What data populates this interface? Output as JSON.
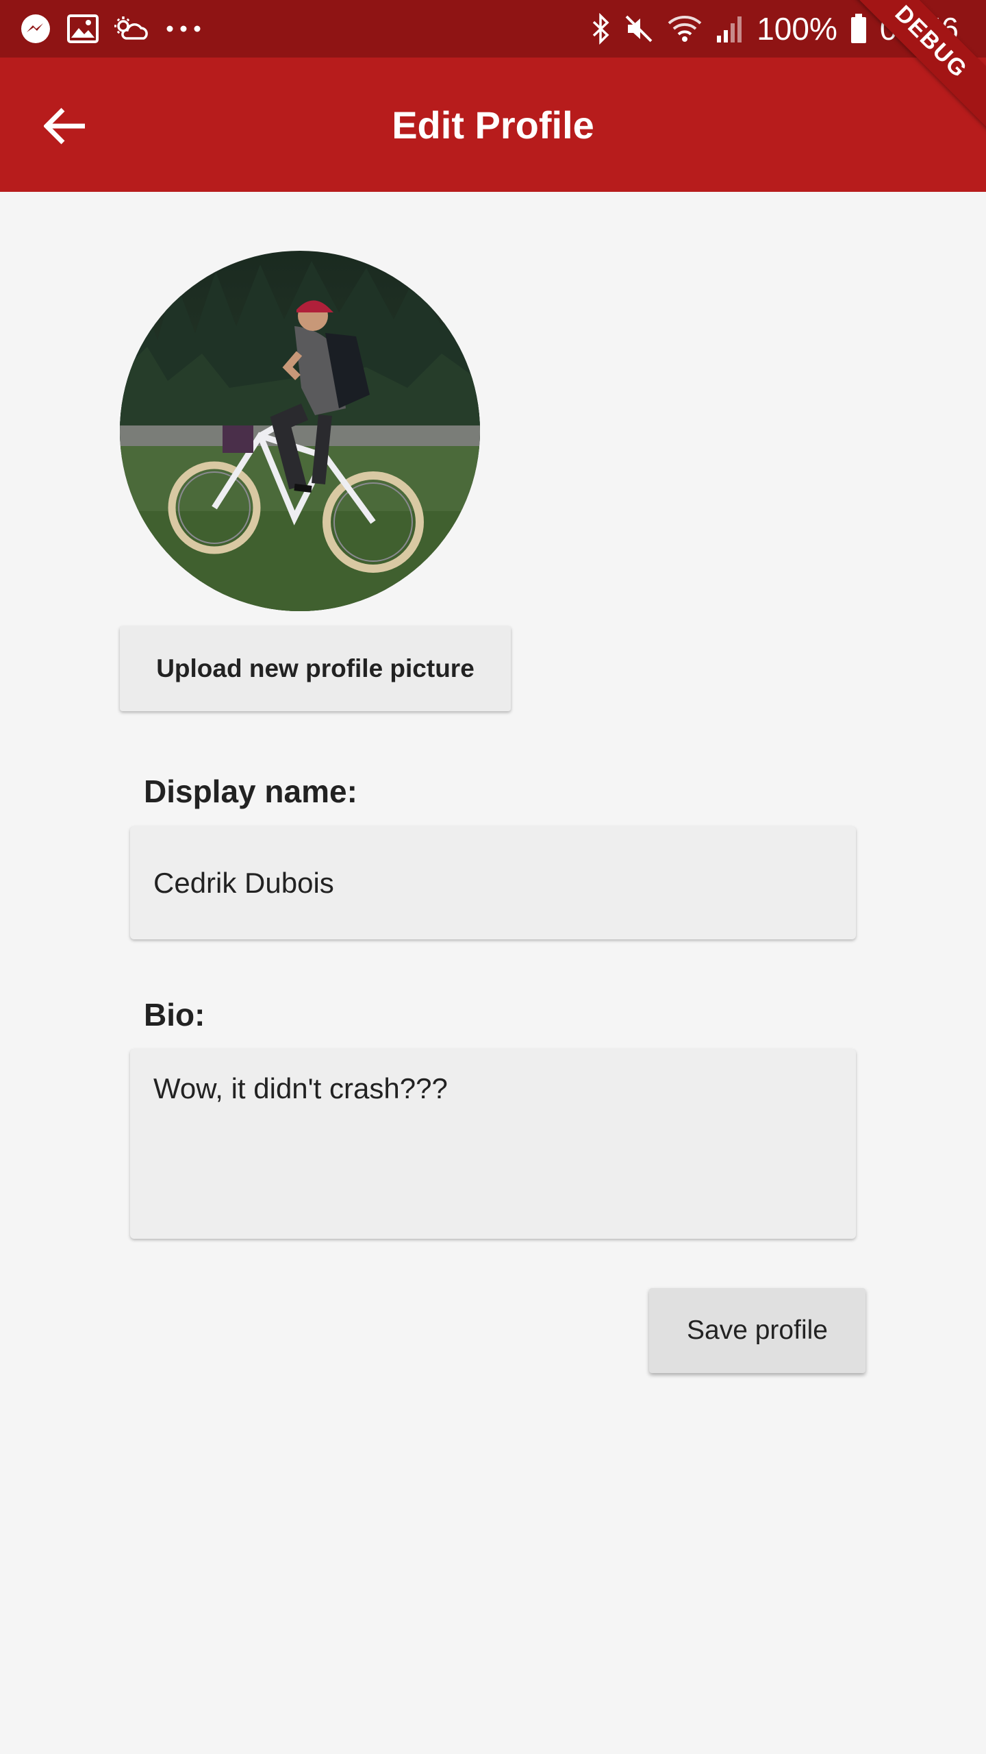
{
  "status_bar": {
    "battery_text": "100%",
    "time": "09:56",
    "icons": [
      "messenger-icon",
      "gallery-icon",
      "weather-icon",
      "more-dots-icon",
      "bluetooth-icon",
      "mute-icon",
      "wifi-icon",
      "signal-icon",
      "battery-icon"
    ]
  },
  "app_bar": {
    "title": "Edit Profile",
    "back_icon": "arrow-back-icon",
    "debug_label": "DEBUG",
    "color": "#b71c1c"
  },
  "profile": {
    "upload_label": "Upload new profile picture",
    "display_name_label": "Display name:",
    "display_name_value": "Cedrik Dubois",
    "bio_label": "Bio:",
    "bio_value": "Wow, it didn't crash???",
    "save_label": "Save profile"
  }
}
